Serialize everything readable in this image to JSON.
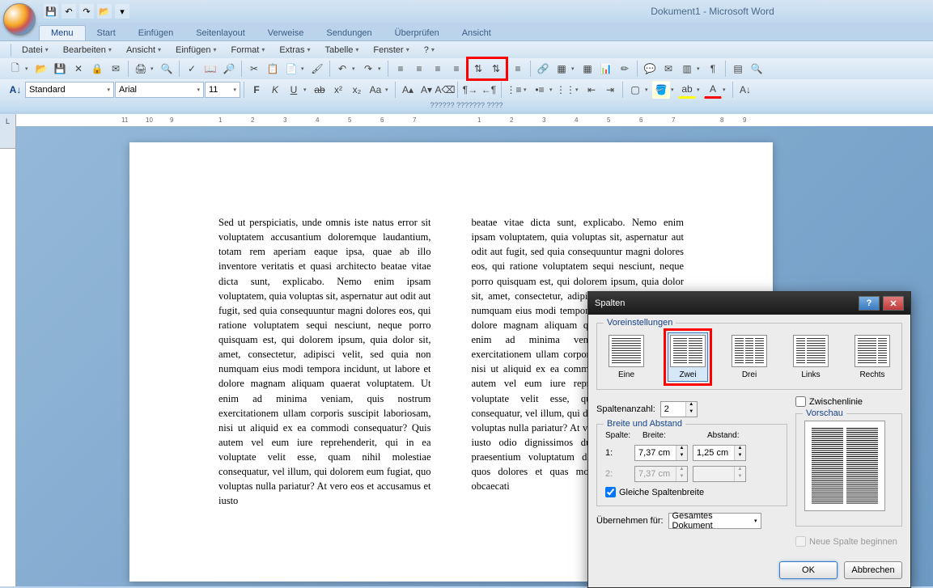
{
  "app_title": "Dokument1 - Microsoft Word",
  "ribbon_tabs": [
    "Menu",
    "Start",
    "Einfügen",
    "Seitenlayout",
    "Verweise",
    "Sendungen",
    "Überprüfen",
    "Ansicht"
  ],
  "classic_menu": [
    "Datei",
    "Bearbeiten",
    "Ansicht",
    "Einfügen",
    "Format",
    "Extras",
    "Tabelle",
    "Fenster",
    "?"
  ],
  "style_combo": "Standard",
  "font_combo": "Arial",
  "size_combo": "11",
  "footer_text": "?????? ??????? ????",
  "ruler_corner": "L",
  "document": {
    "col1": "Sed ut perspiciatis, unde omnis iste natus error sit voluptatem accusantium doloremque laudantium, totam rem aperiam eaque ipsa, quae ab illo inventore veritatis et quasi architecto beatae vitae dicta sunt, explicabo. Nemo enim ipsam voluptatem, quia voluptas sit, aspernatur aut odit aut fugit, sed quia consequuntur magni dolores eos, qui ratione voluptatem sequi nesciunt, neque porro quisquam est, qui dolorem ipsum, quia dolor sit, amet, consectetur, adipisci velit, sed quia non numquam eius modi tempora incidunt, ut labore et dolore magnam aliquam quaerat voluptatem. Ut enim ad minima veniam, quis nostrum exercitationem ullam corporis suscipit laboriosam, nisi ut aliquid ex ea commodi consequatur? Quis autem vel eum iure reprehenderit, qui in ea voluptate velit esse, quam nihil molestiae consequatur, vel illum, qui dolorem eum fugiat, quo voluptas nulla pariatur? At vero eos et accusamus et iusto",
    "col2": "beatae vitae dicta sunt, explicabo. Nemo enim ipsam voluptatem, quia voluptas sit, aspernatur aut odit aut fugit, sed quia consequuntur magni dolores eos, qui ratione voluptatem sequi nesciunt, neque porro quisquam est, qui dolorem ipsum, quia dolor sit, amet, consectetur, adipisci velit, sed quia non numquam eius modi tempora incidunt, ut labore et dolore magnam aliquam quaerat voluptatem. Ut enim ad minima veniam, quis nostrum exercitationem ullam corporis suscipit laboriosam, nisi ut aliquid ex ea commodi consequatur? Quis autem vel eum iure reprehenderit, qui in ea voluptate velit esse, quam nihil molestiae consequatur, vel illum, qui dolorem eum fugiat, quo voluptas nulla pariatur? At vero eos et accusamus et iusto odio dignissimos ducimus, qui blanditiis praesentium voluptatum deleniti atque corrupti, quos dolores et quas molestias excepturi sint, obcaecati"
  },
  "dialog": {
    "title": "Spalten",
    "group_presets": "Voreinstellungen",
    "presets": {
      "one": "Eine",
      "two": "Zwei",
      "three": "Drei",
      "left": "Links",
      "right": "Rechts"
    },
    "col_count_label": "Spaltenanzahl:",
    "col_count_value": "2",
    "divider_label": "Zwischenlinie",
    "group_width": "Breite und Abstand",
    "hdr_col": "Spalte:",
    "hdr_width": "Breite:",
    "hdr_gap": "Abstand:",
    "row1": {
      "num": "1:",
      "width": "7,37 cm",
      "gap": "1,25 cm"
    },
    "row2": {
      "num": "2:",
      "width": "7,37 cm",
      "gap": ""
    },
    "equal_label": "Gleiche Spaltenbreite",
    "group_preview": "Vorschau",
    "apply_label": "Übernehmen für:",
    "apply_value": "Gesamtes Dokument",
    "new_col_label": "Neue Spalte beginnen",
    "ok": "OK",
    "cancel": "Abbrechen"
  }
}
